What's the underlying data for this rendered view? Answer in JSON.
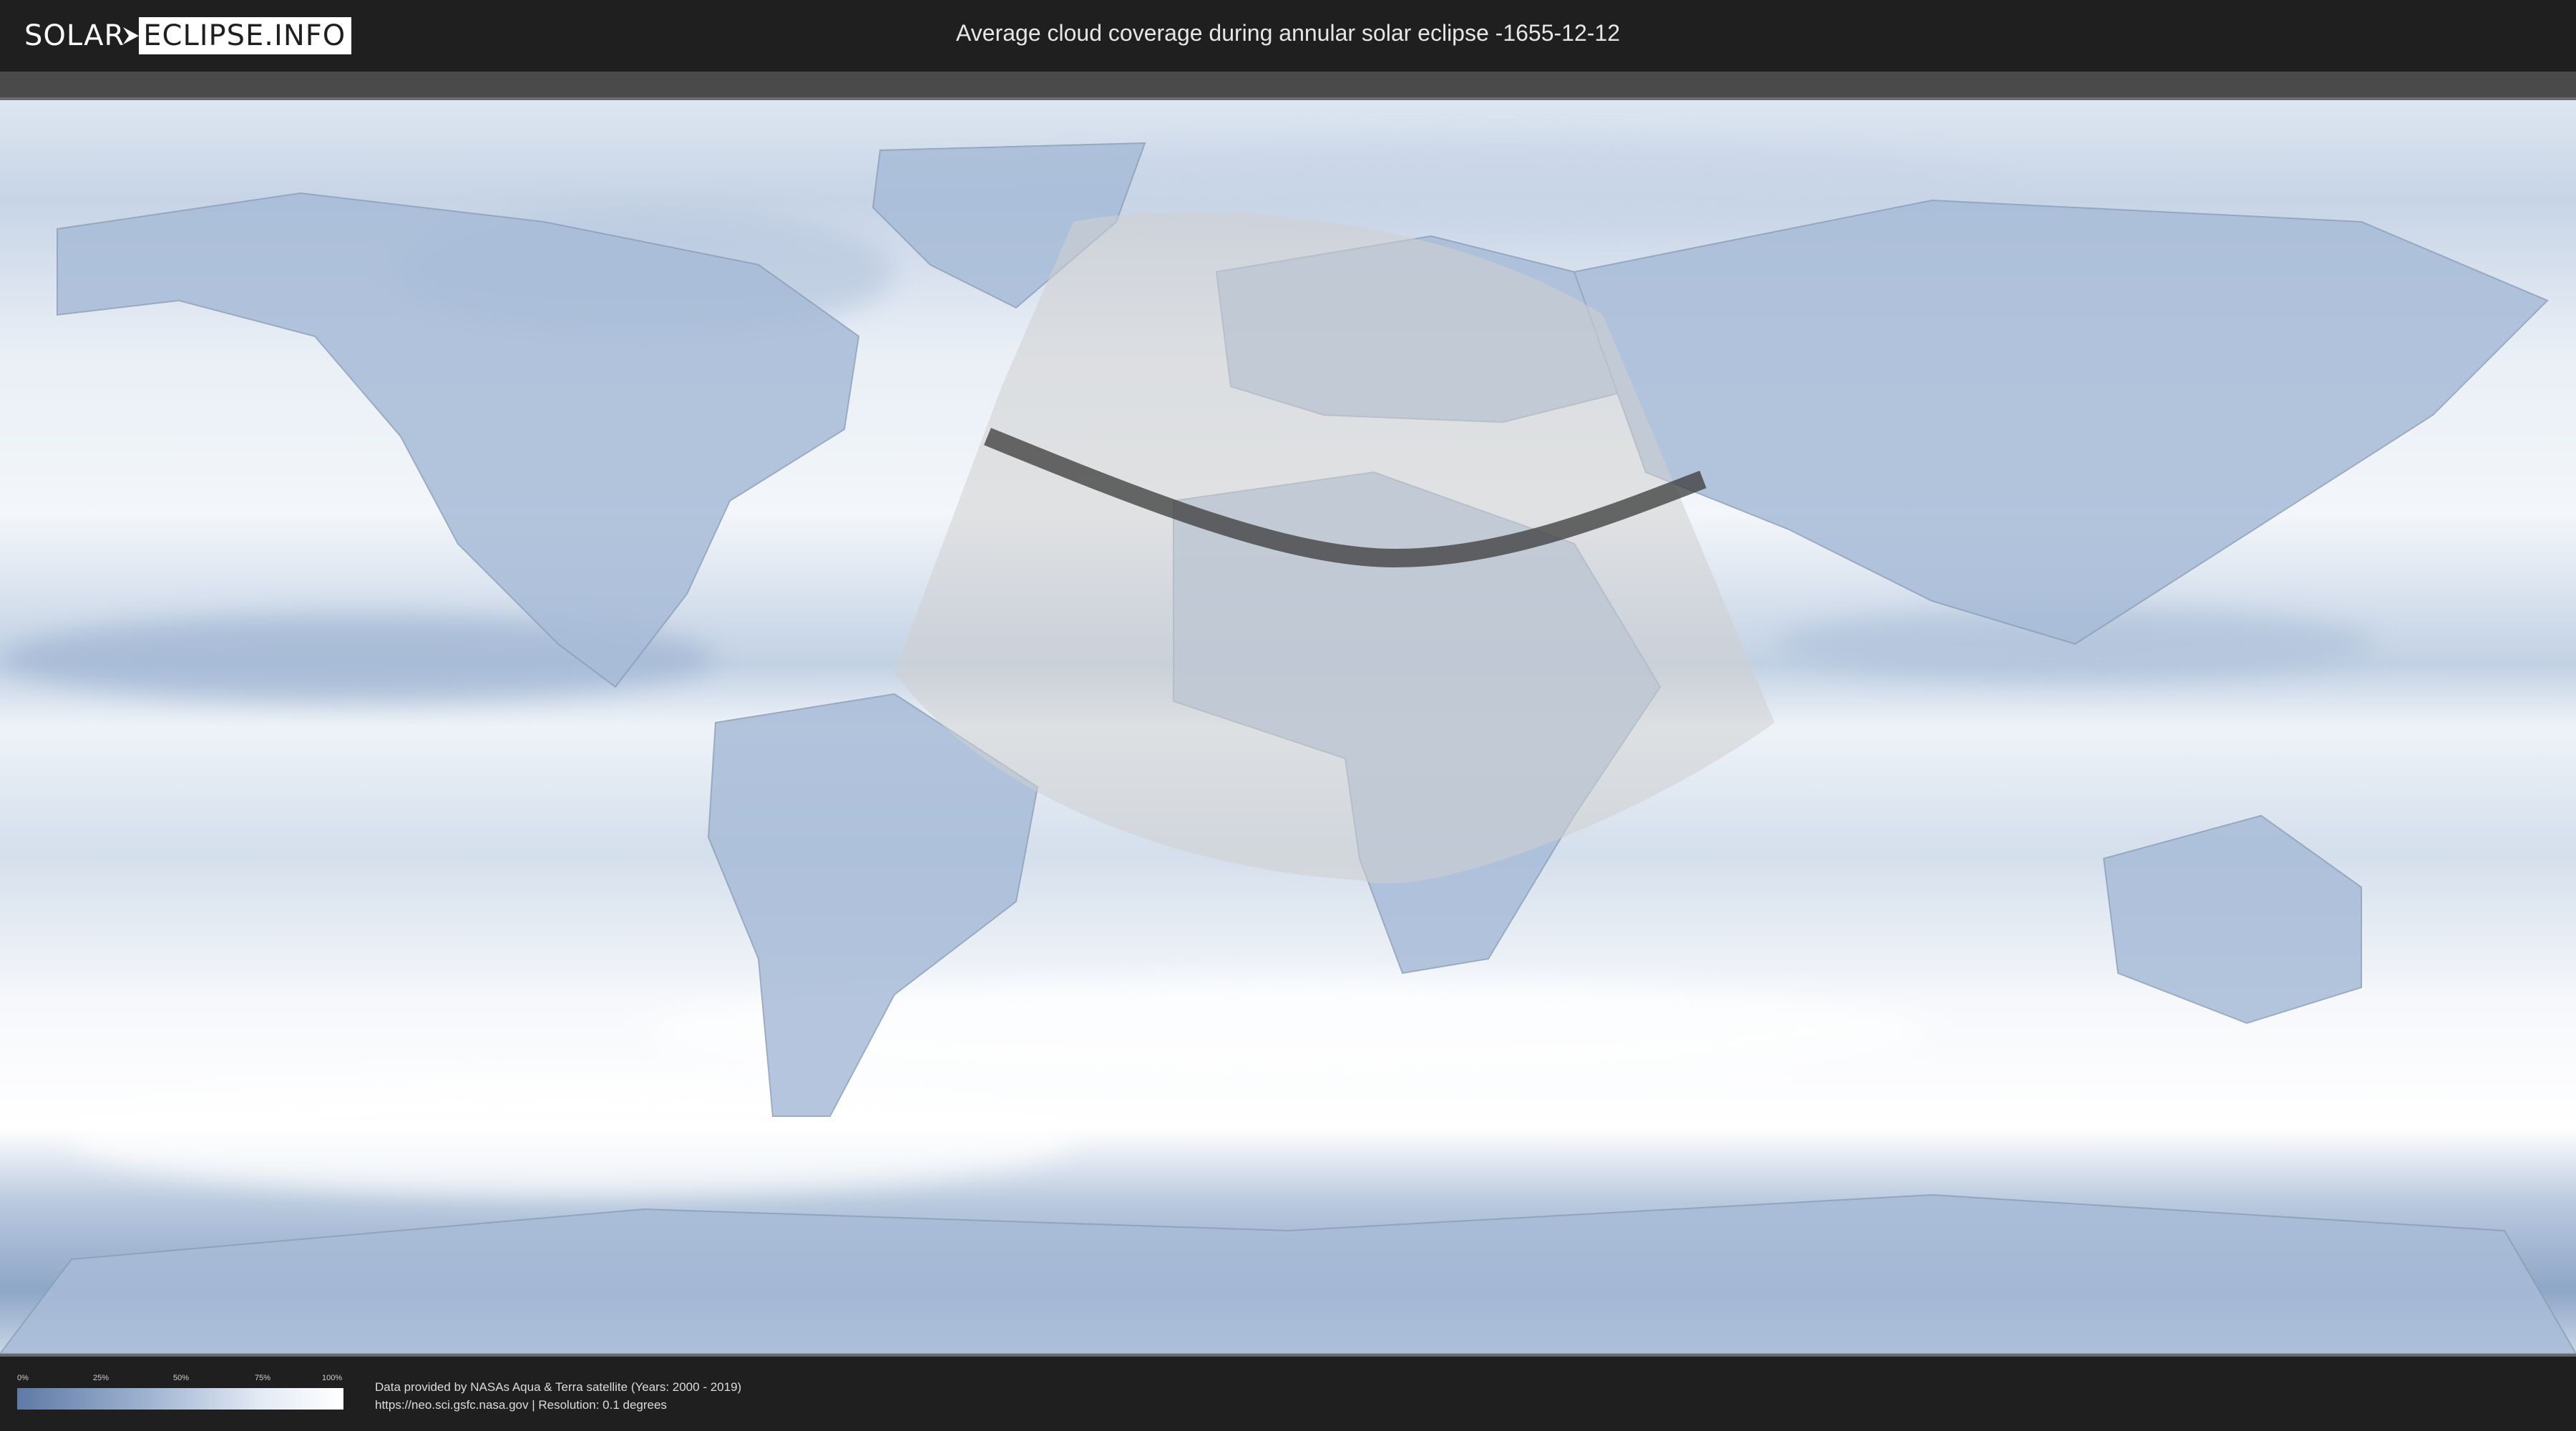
{
  "header": {
    "logo_part1": "SOLAR",
    "logo_part2": "ECLIPSE.INFO",
    "title": "Average cloud coverage during annular solar eclipse -1655-12-12"
  },
  "legend": {
    "labels": [
      "0%",
      "25%",
      "50%",
      "75%",
      "100%"
    ],
    "gradient_colors": [
      "#5f7aa6",
      "#9fb3d1",
      "#e4ebf4",
      "#ffffff"
    ]
  },
  "footer": {
    "credit_line1": "Data provided by NASAs Aqua & Terra satellite (Years: 2000 - 2019)",
    "credit_line2": "https://neo.sci.gsfc.nasa.gov | Resolution: 0.1 degrees"
  },
  "map": {
    "projection": "equirectangular",
    "cloud_color_low": "#5f7aa6",
    "cloud_color_high": "#ffffff",
    "eclipse_visibility_color": "#cfcfcf",
    "eclipse_path_color": "#3a3a3a"
  }
}
